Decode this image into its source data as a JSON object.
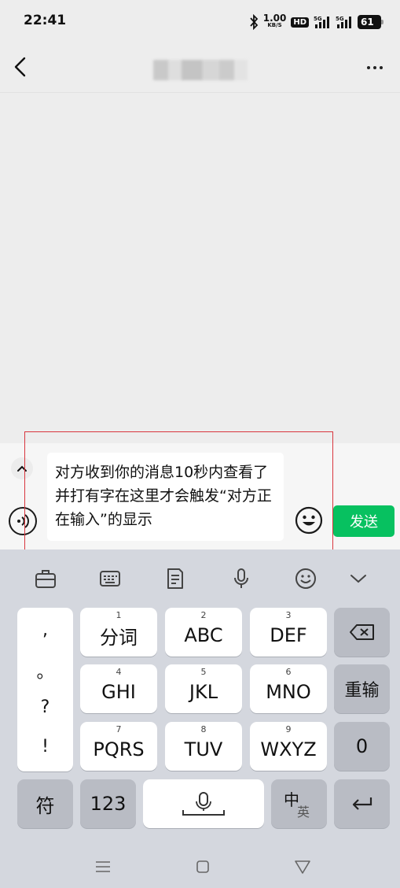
{
  "status_bar": {
    "time": "22:41",
    "net_speed": "1.00",
    "net_unit": "KB/S",
    "hd_label": "HD",
    "signal_label_1": "5G",
    "signal_label_2": "5G",
    "battery": "61"
  },
  "header": {
    "more_icon": "more-dots-icon",
    "back_icon": "chevron-left-icon"
  },
  "input_bar": {
    "message_text": "对方收到你的消息10秒内查看了并打有字在这里才会触发“对方正在输入”的显示",
    "send_label": "发送"
  },
  "keyboard": {
    "punctuation": [
      ",",
      "。",
      "?",
      "!"
    ],
    "row1": [
      {
        "num": "1",
        "label": "分词"
      },
      {
        "num": "2",
        "label": "ABC"
      },
      {
        "num": "3",
        "label": "DEF"
      }
    ],
    "row2": [
      {
        "num": "4",
        "label": "GHI"
      },
      {
        "num": "5",
        "label": "JKL"
      },
      {
        "num": "6",
        "label": "MNO"
      }
    ],
    "row3": [
      {
        "num": "7",
        "label": "PQRS"
      },
      {
        "num": "8",
        "label": "TUV"
      },
      {
        "num": "9",
        "label": "WXYZ"
      }
    ],
    "reenter_label": "重输",
    "zero_label": "0",
    "symbol_label": "符",
    "numeric_label": "123",
    "lang_main": "中",
    "lang_sub": "英"
  },
  "colors": {
    "send_green": "#07c160",
    "highlight_red": "#d9363e",
    "keyboard_bg": "#d4d7de"
  }
}
